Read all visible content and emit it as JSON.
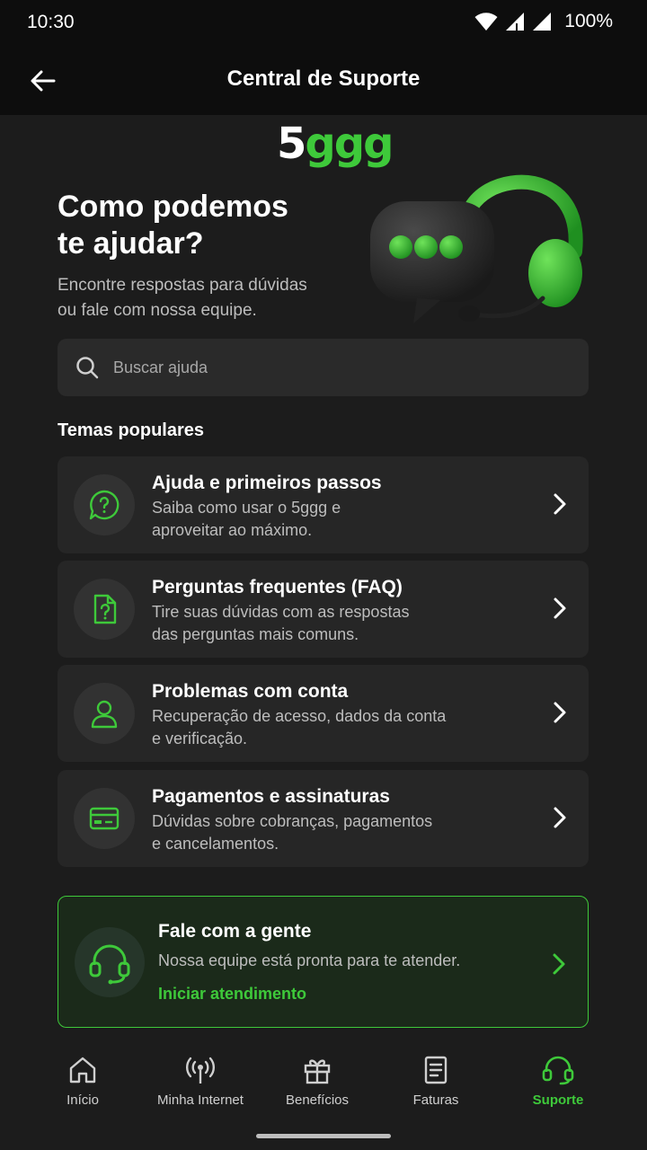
{
  "status_bar": {
    "time": "10:30",
    "battery": "100%"
  },
  "app_bar": {
    "title": "Central de Suporte"
  },
  "logo": {
    "number": "5",
    "text": "ggg"
  },
  "hero": {
    "title_line1": "Como podemos",
    "title_line2": "te ajudar?",
    "subtitle_line1": "Encontre respostas para dúvidas",
    "subtitle_line2": "ou fale com nossa equipe."
  },
  "search": {
    "placeholder": "Buscar ajuda",
    "value": ""
  },
  "popular": {
    "title": "Temas populares",
    "topics": [
      {
        "title": "Ajuda e primeiros passos",
        "desc_line1": "Saiba como usar o 5ggg e",
        "desc_line2": "aproveitar ao máximo.",
        "icon": "question-chat-icon"
      },
      {
        "title": "Perguntas frequentes (FAQ)",
        "desc_line1": "Tire suas dúvidas com as respostas",
        "desc_line2": "das perguntas mais comuns.",
        "icon": "faq-document-icon"
      },
      {
        "title": "Problemas com conta",
        "desc_line1": "Recuperação de acesso, dados da conta",
        "desc_line2": "e verificação.",
        "icon": "user-icon"
      },
      {
        "title": "Pagamentos e assinaturas",
        "desc_line1": "Dúvidas sobre cobranças, pagamentos",
        "desc_line2": "e cancelamentos.",
        "icon": "credit-card-icon"
      }
    ]
  },
  "contact": {
    "title": "Fale com a gente",
    "desc": "Nossa equipe está pronta para te atender.",
    "link": "Iniciar atendimento"
  },
  "bottom_nav": [
    {
      "label": "Início",
      "icon": "home-icon",
      "active": false
    },
    {
      "label": "Minha Internet",
      "icon": "antenna-icon",
      "active": false
    },
    {
      "label": "Benefícios",
      "icon": "gift-icon",
      "active": false
    },
    {
      "label": "Faturas",
      "icon": "invoice-icon",
      "active": false
    },
    {
      "label": "Suporte",
      "icon": "headset-icon",
      "active": true
    }
  ],
  "colors": {
    "accent": "#3ec93a",
    "background": "#1c1c1c",
    "card": "#262626",
    "bar": "#0d0d0d"
  }
}
